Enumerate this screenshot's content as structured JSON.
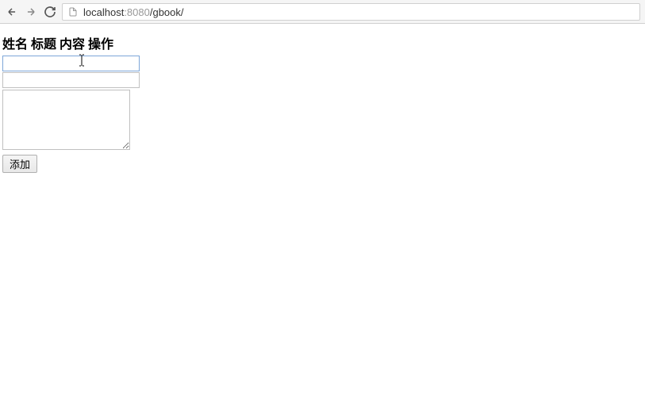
{
  "browser": {
    "url_host": "localhost",
    "url_port": ":8080",
    "url_path": "/gbook/"
  },
  "table": {
    "headers": [
      "姓名",
      "标题",
      "内容",
      "操作"
    ]
  },
  "form": {
    "name_value": "",
    "title_value": "",
    "content_value": "",
    "submit_label": "添加"
  }
}
